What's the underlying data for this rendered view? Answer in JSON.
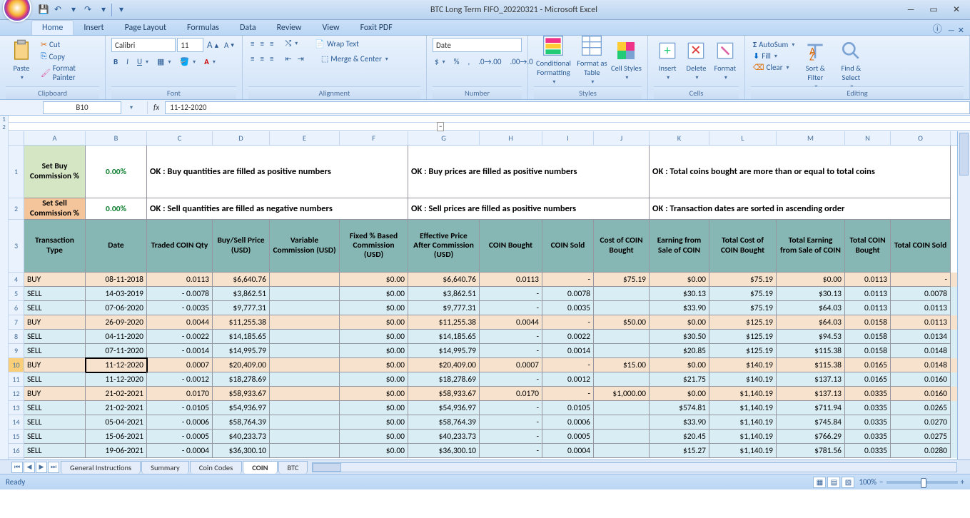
{
  "title": "BTC Long Term FIFO_20220321 - Microsoft Excel",
  "qat": {
    "save": "💾",
    "undo": "↶",
    "redo": "↷"
  },
  "win": {
    "min": "—",
    "max": "▭",
    "close": "✕"
  },
  "tabs": [
    "Home",
    "Insert",
    "Page Layout",
    "Formulas",
    "Data",
    "Review",
    "View",
    "Foxit PDF"
  ],
  "activeTab": "Home",
  "ribbon": {
    "clipboard": {
      "paste": "Paste",
      "cut": "Cut",
      "copy": "Copy",
      "fmtpainter": "Format Painter",
      "label": "Clipboard"
    },
    "font": {
      "name": "Calibri",
      "size": "11",
      "label": "Font"
    },
    "alignment": {
      "wrap": "Wrap Text",
      "merge": "Merge & Center",
      "label": "Alignment"
    },
    "number": {
      "fmt": "Date",
      "label": "Number"
    },
    "styles": {
      "cond": "Conditional Formatting",
      "tbl": "Format as Table",
      "cell": "Cell Styles",
      "label": "Styles"
    },
    "cells": {
      "ins": "Insert",
      "del": "Delete",
      "fmt": "Format",
      "label": "Cells"
    },
    "editing": {
      "auto": "AutoSum",
      "fill": "Fill",
      "clear": "Clear",
      "sort": "Sort & Filter",
      "find": "Find & Select",
      "label": "Editing"
    }
  },
  "namebox": "B10",
  "formula": "11-12-2020",
  "colLetters": [
    "A",
    "B",
    "C",
    "D",
    "E",
    "F",
    "G",
    "H",
    "I",
    "J",
    "K",
    "L",
    "M",
    "N",
    "O"
  ],
  "row1": {
    "buycom": "Set Buy Commission %",
    "pct": "0.00%",
    "msg1": "OK : Buy quantities are filled as positive numbers",
    "msg2": "OK : Buy prices are filled as positive numbers",
    "msg3": "OK : Total coins bought are more than or equal to total coins"
  },
  "row2": {
    "sellcom": "Set Sell Commission %",
    "pct": "0.00%",
    "msg1": "OK : Sell quantities are filled as negative numbers",
    "msg2": "OK : Sell prices are filled as positive numbers",
    "msg3": "OK : Transaction dates are sorted in ascending order"
  },
  "headers": [
    "Transaction Type",
    "Date",
    "Traded COIN Qty",
    "Buy/Sell Price (USD)",
    "Variable Commission (USD)",
    "Fixed % Based Commission (USD)",
    "Effective Price After Commission (USD)",
    "COIN Bought",
    "COIN Sold",
    "Cost of COIN Bought",
    "Earning from Sale of COIN",
    "Total Cost of COIN Bought",
    "Total Earning from Sale of COIN",
    "Total COIN Bought",
    "Total COIN Sold"
  ],
  "data": [
    {
      "n": 4,
      "t": "BUY",
      "d": "08-11-2018",
      "q": "0.0113",
      "p": "$6,640.76",
      "v": "",
      "f": "$0.00",
      "e": "$6,640.76",
      "cb": "0.0113",
      "cs": "-",
      "cc": "$75.19",
      "es": "$0.00",
      "tc": "$75.19",
      "te": "$0.00",
      "tb": "0.0113",
      "ts": "-"
    },
    {
      "n": 5,
      "t": "SELL",
      "d": "14-03-2019",
      "dm": "-",
      "q": "0.0078",
      "p": "$3,862.51",
      "v": "",
      "f": "$0.00",
      "e": "$3,862.51",
      "cb": "-",
      "cs": "0.0078",
      "cc": "",
      "es": "$30.13",
      "tc": "$75.19",
      "te": "$30.13",
      "tb": "0.0113",
      "ts": "0.0078"
    },
    {
      "n": 6,
      "t": "SELL",
      "d": "07-06-2020",
      "dm": "-",
      "q": "0.0035",
      "p": "$9,777.31",
      "v": "",
      "f": "$0.00",
      "e": "$9,777.31",
      "cb": "-",
      "cs": "0.0035",
      "cc": "",
      "es": "$33.90",
      "tc": "$75.19",
      "te": "$64.03",
      "tb": "0.0113",
      "ts": "0.0113"
    },
    {
      "n": 7,
      "t": "BUY",
      "d": "26-09-2020",
      "q": "0.0044",
      "p": "$11,255.38",
      "v": "",
      "f": "$0.00",
      "e": "$11,255.38",
      "cb": "0.0044",
      "cs": "-",
      "cc": "$50.00",
      "es": "$0.00",
      "tc": "$125.19",
      "te": "$64.03",
      "tb": "0.0158",
      "ts": "0.0113"
    },
    {
      "n": 8,
      "t": "SELL",
      "d": "04-11-2020",
      "dm": "-",
      "q": "0.0022",
      "p": "$14,185.65",
      "v": "",
      "f": "$0.00",
      "e": "$14,185.65",
      "cb": "-",
      "cs": "0.0022",
      "cc": "",
      "es": "$30.50",
      "tc": "$125.19",
      "te": "$94.53",
      "tb": "0.0158",
      "ts": "0.0134"
    },
    {
      "n": 9,
      "t": "SELL",
      "d": "07-11-2020",
      "dm": "-",
      "q": "0.0014",
      "p": "$14,995.79",
      "v": "",
      "f": "$0.00",
      "e": "$14,995.79",
      "cb": "-",
      "cs": "0.0014",
      "cc": "",
      "es": "$20.85",
      "tc": "$125.19",
      "te": "$115.38",
      "tb": "0.0158",
      "ts": "0.0148"
    },
    {
      "n": 10,
      "t": "BUY",
      "d": "11-12-2020",
      "q": "0.0007",
      "p": "$20,409.00",
      "v": "",
      "f": "$0.00",
      "e": "$20,409.00",
      "cb": "0.0007",
      "cs": "-",
      "cc": "$15.00",
      "es": "$0.00",
      "tc": "$140.19",
      "te": "$115.38",
      "tb": "0.0165",
      "ts": "0.0148",
      "sel": true
    },
    {
      "n": 11,
      "t": "SELL",
      "d": "11-12-2020",
      "dm": "-",
      "q": "0.0012",
      "p": "$18,278.69",
      "v": "",
      "f": "$0.00",
      "e": "$18,278.69",
      "cb": "-",
      "cs": "0.0012",
      "cc": "",
      "es": "$21.75",
      "tc": "$140.19",
      "te": "$137.13",
      "tb": "0.0165",
      "ts": "0.0160"
    },
    {
      "n": 12,
      "t": "BUY",
      "d": "21-02-2021",
      "q": "0.0170",
      "p": "$58,933.67",
      "v": "",
      "f": "$0.00",
      "e": "$58,933.67",
      "cb": "0.0170",
      "cs": "-",
      "cc": "$1,000.00",
      "es": "$0.00",
      "tc": "$1,140.19",
      "te": "$137.13",
      "tb": "0.0335",
      "ts": "0.0160"
    },
    {
      "n": 13,
      "t": "SELL",
      "d": "21-02-2021",
      "dm": "-",
      "q": "0.0105",
      "p": "$54,936.97",
      "v": "",
      "f": "$0.00",
      "e": "$54,936.97",
      "cb": "-",
      "cs": "0.0105",
      "cc": "",
      "es": "$574.81",
      "tc": "$1,140.19",
      "te": "$711.94",
      "tb": "0.0335",
      "ts": "0.0265"
    },
    {
      "n": 14,
      "t": "SELL",
      "d": "05-04-2021",
      "dm": "-",
      "q": "0.0006",
      "p": "$58,764.39",
      "v": "",
      "f": "$0.00",
      "e": "$58,764.39",
      "cb": "-",
      "cs": "0.0006",
      "cc": "",
      "es": "$33.90",
      "tc": "$1,140.19",
      "te": "$745.84",
      "tb": "0.0335",
      "ts": "0.0270"
    },
    {
      "n": 15,
      "t": "SELL",
      "d": "15-06-2021",
      "dm": "-",
      "q": "0.0005",
      "p": "$40,233.73",
      "v": "",
      "f": "$0.00",
      "e": "$40,233.73",
      "cb": "-",
      "cs": "0.0005",
      "cc": "",
      "es": "$20.45",
      "tc": "$1,140.19",
      "te": "$766.29",
      "tb": "0.0335",
      "ts": "0.0275"
    },
    {
      "n": 16,
      "t": "SELL",
      "d": "19-06-2021",
      "dm": "-",
      "q": "0.0004",
      "p": "$36,300.10",
      "v": "",
      "f": "$0.00",
      "e": "$36,300.10",
      "cb": "-",
      "cs": "0.0004",
      "cc": "",
      "es": "$15.27",
      "tc": "$1,140.19",
      "te": "$781.56",
      "tb": "0.0335",
      "ts": "0.0280"
    }
  ],
  "sheets": [
    "General Instructions",
    "Summary",
    "Coin Codes",
    "COIN",
    "BTC"
  ],
  "activeSheet": "COIN",
  "status": "Ready",
  "zoom": "100%"
}
